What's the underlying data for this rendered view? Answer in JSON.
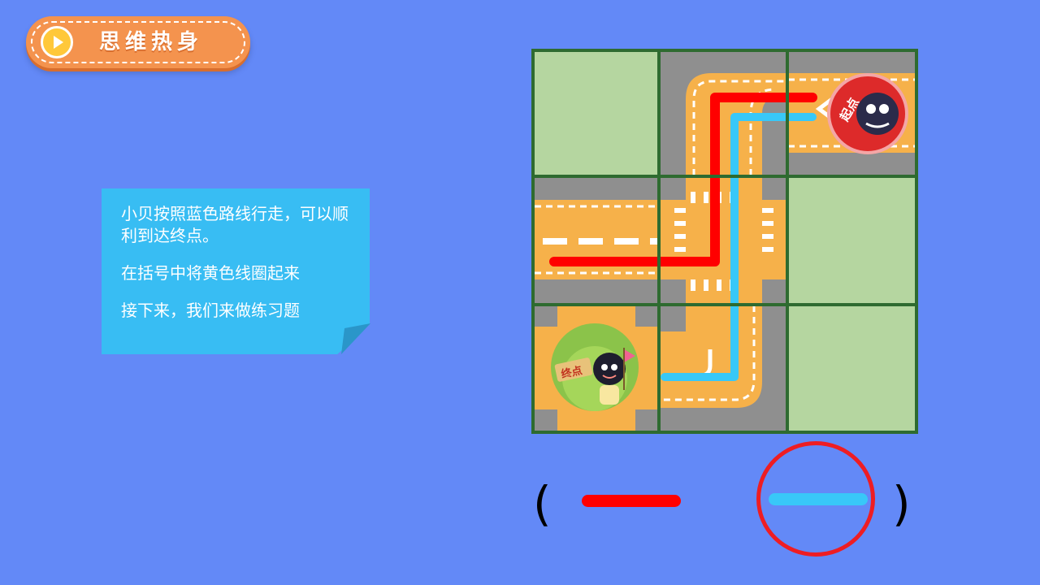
{
  "header": {
    "title": "思维热身",
    "icon": "play-icon",
    "colors": {
      "badge": "#F4934E",
      "play": "#FFC83A"
    }
  },
  "instructions": {
    "line1": "小贝按照蓝色路线行走，可以顺利到达终点。",
    "line2": "在括号中将黄色线圈起来",
    "line3": "接下来，我们来做练习题"
  },
  "map": {
    "grid": [
      3,
      3
    ],
    "start_label": "起点",
    "end_label": "终点",
    "routes": [
      {
        "name": "red",
        "color": "#FF0000"
      },
      {
        "name": "blue",
        "color": "#38C8F8"
      }
    ],
    "colors": {
      "grass": "#B5D6A0",
      "road": "#8F8F8F",
      "lane": "#F6B14A",
      "border": "#2E6B30"
    }
  },
  "answer": {
    "open_paren": "(",
    "close_paren": ")",
    "options": [
      {
        "name": "red-line",
        "color": "#FF0000",
        "selected": false
      },
      {
        "name": "blue-line",
        "color": "#38C8F8",
        "selected": true
      }
    ],
    "circle_color": "#EE1D23"
  }
}
